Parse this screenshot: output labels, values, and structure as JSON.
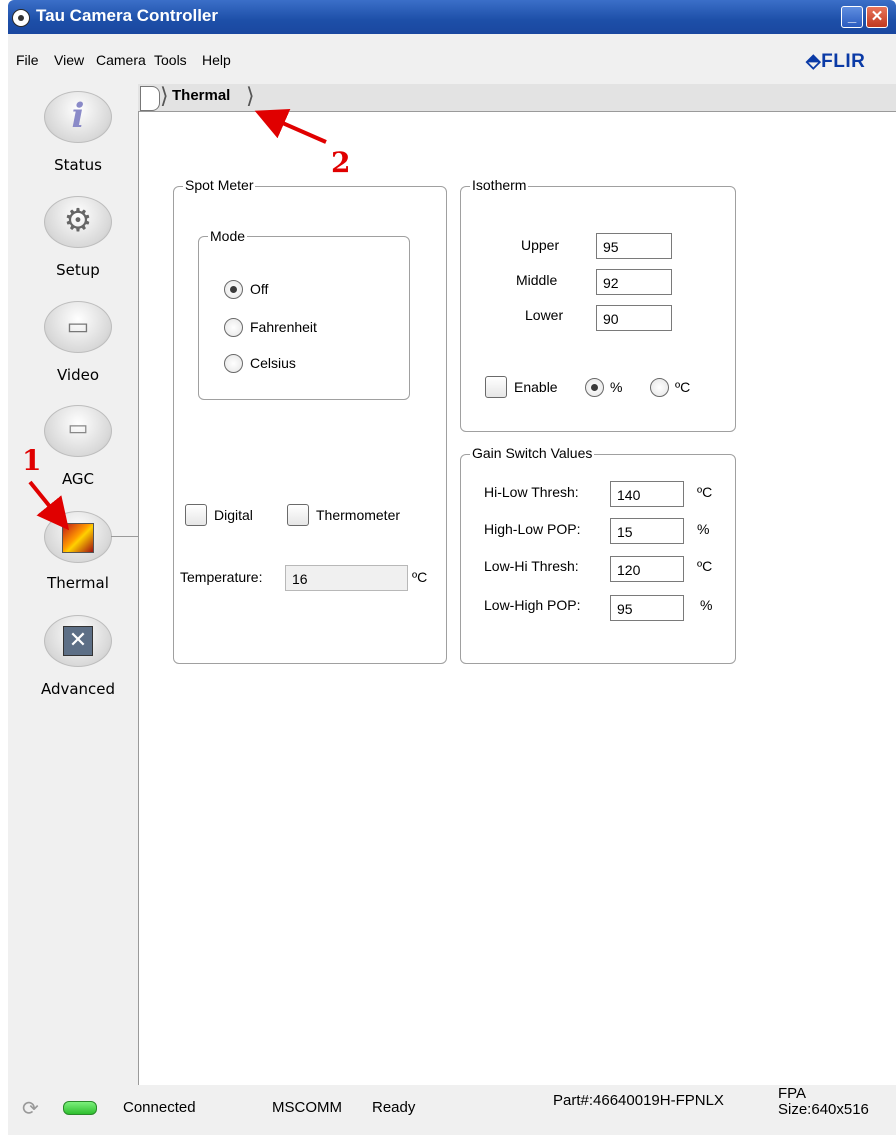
{
  "window": {
    "title": "Tau Camera Controller",
    "minimize_glyph": "_",
    "close_glyph": "✕"
  },
  "menu": [
    "File",
    "View",
    "Camera",
    "Tools",
    "Help"
  ],
  "logo": "FLIR",
  "sidebar": [
    {
      "label": "Status",
      "icon": "info-icon"
    },
    {
      "label": "Setup",
      "icon": "gear-icon"
    },
    {
      "label": "Video",
      "icon": "monitor-icon"
    },
    {
      "label": "AGC",
      "icon": "agc-icon"
    },
    {
      "label": "Thermal",
      "icon": "thermal-icon"
    },
    {
      "label": "Advanced",
      "icon": "tools-icon"
    }
  ],
  "breadcrumb": "Thermal",
  "spot_meter": {
    "legend": "Spot Meter",
    "mode_legend": "Mode",
    "modes": [
      {
        "label": "Off",
        "checked": true
      },
      {
        "label": "Fahrenheit",
        "checked": false
      },
      {
        "label": "Celsius",
        "checked": false
      }
    ],
    "digital_label": "Digital",
    "thermometer_label": "Thermometer",
    "temperature_label": "Temperature:",
    "temperature_value": "16",
    "temperature_unit": "ºC"
  },
  "isotherm": {
    "legend": "Isotherm",
    "upper_label": "Upper",
    "upper_value": "95",
    "middle_label": "Middle",
    "middle_value": "92",
    "lower_label": "Lower",
    "lower_value": "90",
    "enable_label": "Enable",
    "percent_label": "%",
    "celsius_label": "ºC"
  },
  "gain_switch": {
    "legend": "Gain Switch Values",
    "rows": [
      {
        "label": "Hi-Low Thresh:",
        "value": "140",
        "unit": "ºC"
      },
      {
        "label": "High-Low POP:",
        "value": "15",
        "unit": "%"
      },
      {
        "label": "Low-Hi Thresh:",
        "value": "120",
        "unit": "ºC"
      },
      {
        "label": "Low-High POP:",
        "value": "95",
        "unit": "%"
      }
    ]
  },
  "statusbar": {
    "connection": "Connected",
    "port": "MSCOMM",
    "state": "Ready",
    "part": "Part#:46640019H-FPNLX",
    "fpa_line1": "FPA",
    "fpa_line2": "Size:640x516"
  },
  "annotations": {
    "marker1": "1",
    "marker2": "2"
  },
  "colors": {
    "titlebar": "#1d4fa8",
    "annotation": "#e00000",
    "status_led": "#33cc33",
    "logo": "#0a3aa6"
  }
}
